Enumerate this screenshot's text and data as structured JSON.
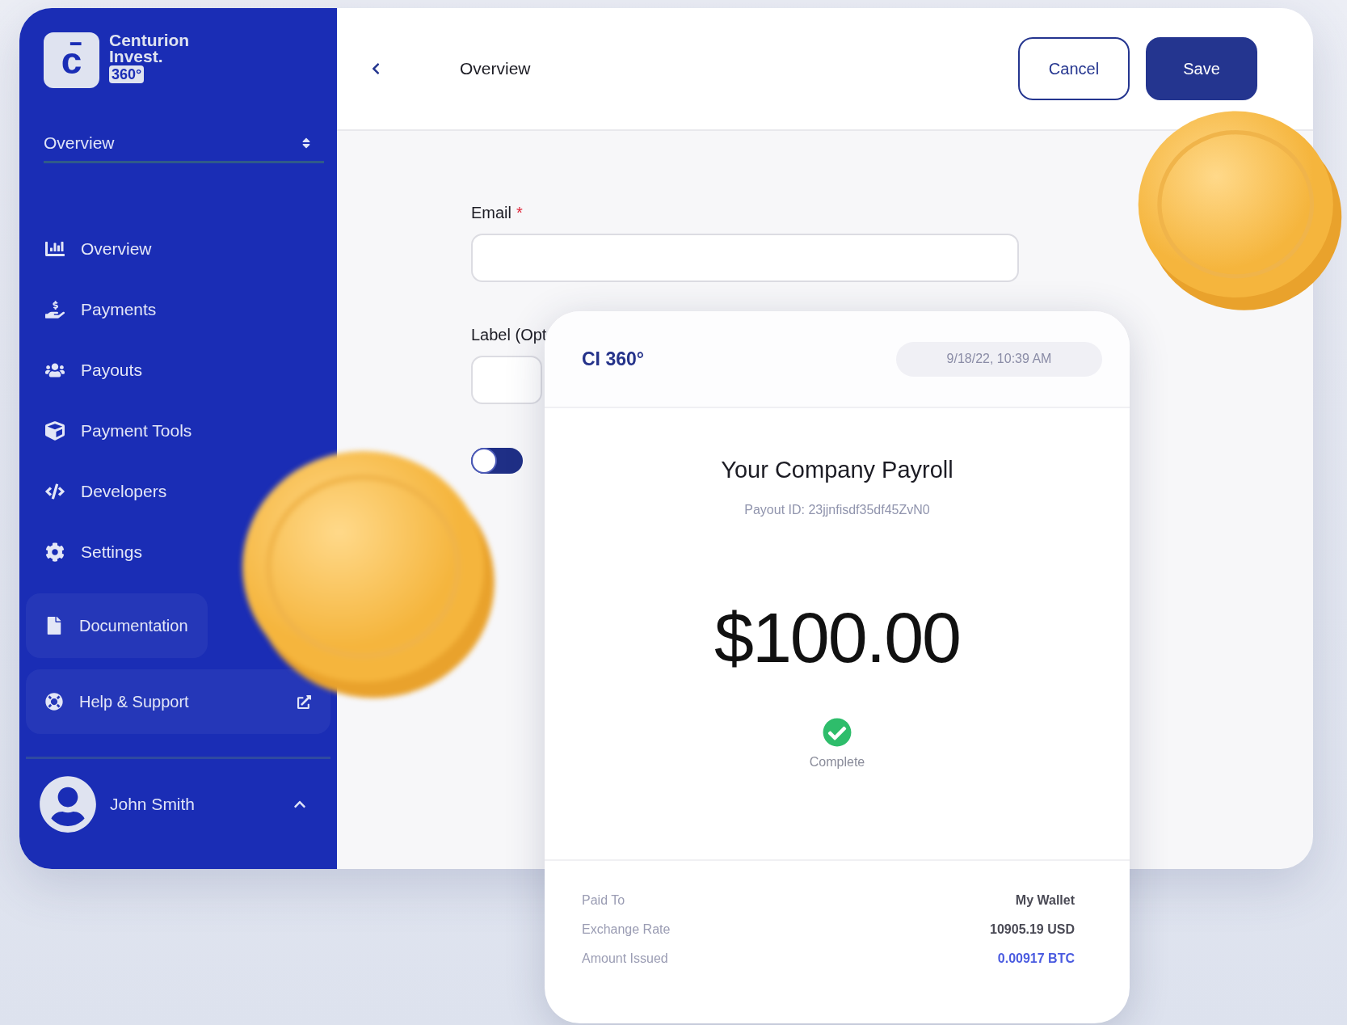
{
  "brand": {
    "mark": "c̄",
    "name_line_1": "Centurion",
    "name_line_2": "Invest.",
    "badge": "360°"
  },
  "section_select": {
    "value": "Overview"
  },
  "nav": [
    {
      "label": "Overview"
    },
    {
      "label": "Payments"
    },
    {
      "label": "Payouts"
    },
    {
      "label": "Payment Tools"
    },
    {
      "label": "Developers"
    },
    {
      "label": "Settings"
    }
  ],
  "resources": [
    {
      "label": "Documentation",
      "external": false
    },
    {
      "label": "Help & Support",
      "external": true
    }
  ],
  "user": {
    "name": "John Smith"
  },
  "header": {
    "title": "Overview",
    "buttons": [
      {
        "label": "Cancel",
        "kind": "secondary"
      },
      {
        "label": "Save",
        "kind": "primary"
      }
    ]
  },
  "form": {
    "email_label": "Email",
    "required_mark": "*",
    "label_label": "Label (Opt",
    "toggle_on": false
  },
  "receipt": {
    "brand": "CI 360°",
    "date": "9/18/22, 10:39 AM",
    "title": "Your Company Payroll",
    "payout_id": "Payout ID: 23jjnfisdf35df45ZvN0",
    "amount": "$100.00",
    "status": "Complete",
    "details": [
      {
        "label": "Paid To",
        "value": "My Wallet",
        "highlight": false
      },
      {
        "label": "Exchange Rate",
        "value": "10905.19 USD",
        "highlight": false
      },
      {
        "label": "Amount Issued",
        "value": "0.00917 BTC",
        "highlight": true
      }
    ]
  }
}
